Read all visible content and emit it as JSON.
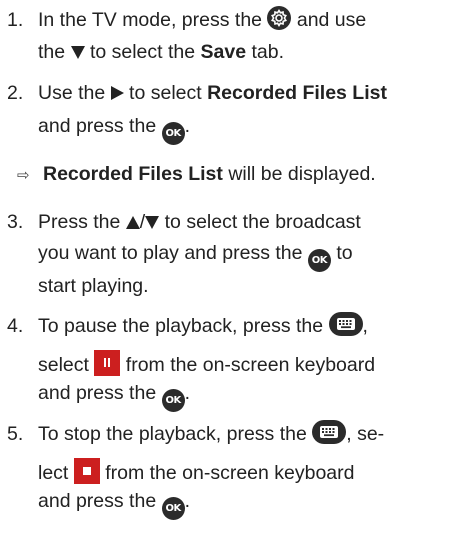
{
  "steps": [
    {
      "number": "1.",
      "segments": {
        "a": "In the TV mode, press the",
        "b": "and use",
        "c": "the",
        "d": "to select the",
        "e": "Save",
        "f": "tab."
      },
      "icons": [
        "settings-gear-icon",
        "down-arrow-icon"
      ]
    },
    {
      "number": "2.",
      "segments": {
        "a": "Use the",
        "b": "to select",
        "c": "Recorded Files List",
        "d": "and press the",
        "e": "."
      },
      "icons": [
        "right-arrow-icon",
        "ok-button-icon"
      ]
    },
    {
      "number": "3.",
      "segments": {
        "a": "Press the",
        "b": "/",
        "c": "to select the broadcast",
        "d": "you want to play and press the",
        "e": "to",
        "f": "start playing."
      },
      "icons": [
        "up-arrow-icon",
        "down-arrow-icon",
        "ok-button-icon"
      ]
    },
    {
      "number": "4.",
      "segments": {
        "a": "To pause the playback, press the",
        "b": ",",
        "c": "select",
        "d": "from the on-screen keyboard",
        "e": "and press the",
        "f": "."
      },
      "icons": [
        "keyboard-button-icon",
        "pause-key-icon",
        "ok-button-icon"
      ]
    },
    {
      "number": "5.",
      "segments": {
        "a": "To stop the playback, press the",
        "b": ", se-",
        "c": "lect",
        "d": "from the on-screen keyboard",
        "e": "and press the",
        "f": "."
      },
      "icons": [
        "keyboard-button-icon",
        "stop-key-icon",
        "ok-button-icon"
      ]
    }
  ],
  "result": {
    "bold": "Recorded Files List",
    "rest": "will be displayed."
  },
  "ok_label": "OK",
  "colors": {
    "text": "#222222",
    "icon_dark": "#2b2b2b",
    "key_red": "#cc1f1f"
  }
}
